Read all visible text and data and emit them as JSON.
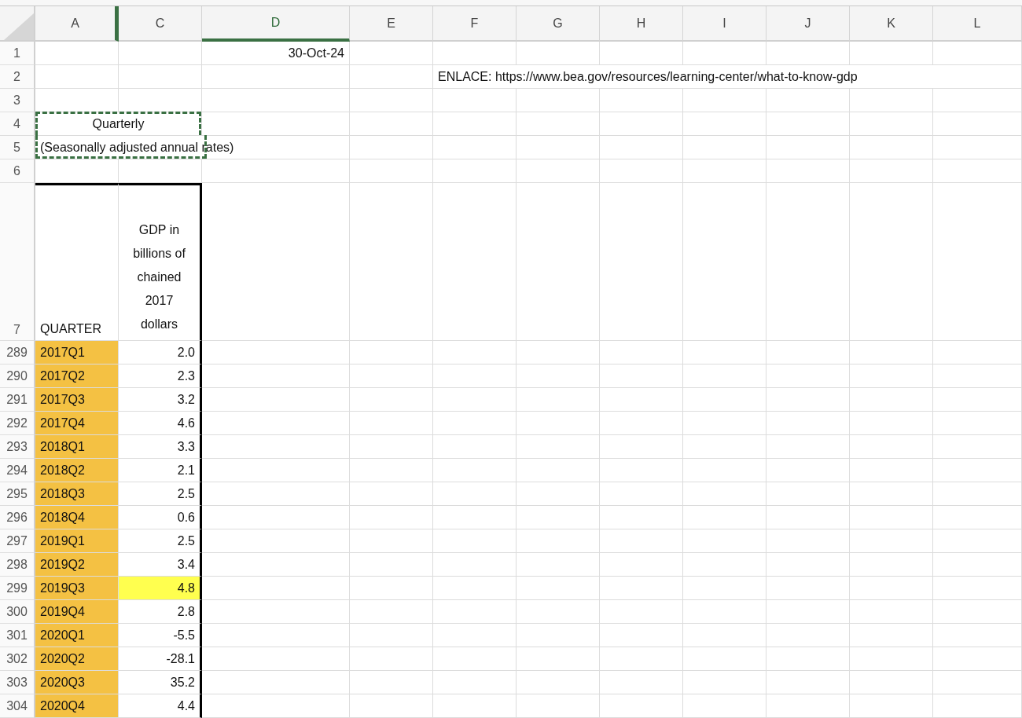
{
  "columns": [
    {
      "label": "A",
      "selected": false
    },
    {
      "label": "C",
      "selected": false
    },
    {
      "label": "D",
      "selected": true
    },
    {
      "label": "E",
      "selected": false
    },
    {
      "label": "F",
      "selected": false
    },
    {
      "label": "G",
      "selected": false
    },
    {
      "label": "H",
      "selected": false
    },
    {
      "label": "I",
      "selected": false
    },
    {
      "label": "J",
      "selected": false
    },
    {
      "label": "K",
      "selected": false
    },
    {
      "label": "L",
      "selected": false
    }
  ],
  "top_rows": [
    {
      "row": "1",
      "date": "30-Oct-24"
    },
    {
      "row": "2",
      "link": "ENLACE: https://www.bea.gov/resources/learning-center/what-to-know-gdp"
    },
    {
      "row": "3"
    },
    {
      "row": "4",
      "title": "Quarterly",
      "copied": true
    },
    {
      "row": "5",
      "subtitle": "(Seasonally adjusted annual rates)",
      "copied": true
    },
    {
      "row": "6"
    }
  ],
  "header_row": {
    "row": "7",
    "quarter": "QUARTER",
    "value": "GDP in billions of chained 2017 dollars"
  },
  "data_rows": [
    {
      "row": "289",
      "quarter": "2017Q1",
      "value": "2.0",
      "highlighted": false
    },
    {
      "row": "290",
      "quarter": "2017Q2",
      "value": "2.3",
      "highlighted": false
    },
    {
      "row": "291",
      "quarter": "2017Q3",
      "value": "3.2",
      "highlighted": false
    },
    {
      "row": "292",
      "quarter": "2017Q4",
      "value": "4.6",
      "highlighted": false
    },
    {
      "row": "293",
      "quarter": "2018Q1",
      "value": "3.3",
      "highlighted": false
    },
    {
      "row": "294",
      "quarter": "2018Q2",
      "value": "2.1",
      "highlighted": false
    },
    {
      "row": "295",
      "quarter": "2018Q3",
      "value": "2.5",
      "highlighted": false
    },
    {
      "row": "296",
      "quarter": "2018Q4",
      "value": "0.6",
      "highlighted": false
    },
    {
      "row": "297",
      "quarter": "2019Q1",
      "value": "2.5",
      "highlighted": false
    },
    {
      "row": "298",
      "quarter": "2019Q2",
      "value": "3.4",
      "highlighted": false
    },
    {
      "row": "299",
      "quarter": "2019Q3",
      "value": "4.8",
      "highlighted": true
    },
    {
      "row": "300",
      "quarter": "2019Q4",
      "value": "2.8",
      "highlighted": false
    },
    {
      "row": "301",
      "quarter": "2020Q1",
      "value": "-5.5",
      "highlighted": false
    },
    {
      "row": "302",
      "quarter": "2020Q2",
      "value": "-28.1",
      "highlighted": false
    },
    {
      "row": "303",
      "quarter": "2020Q3",
      "value": "35.2",
      "highlighted": false
    },
    {
      "row": "304",
      "quarter": "2020Q4",
      "value": "4.4",
      "highlighted": false
    }
  ]
}
